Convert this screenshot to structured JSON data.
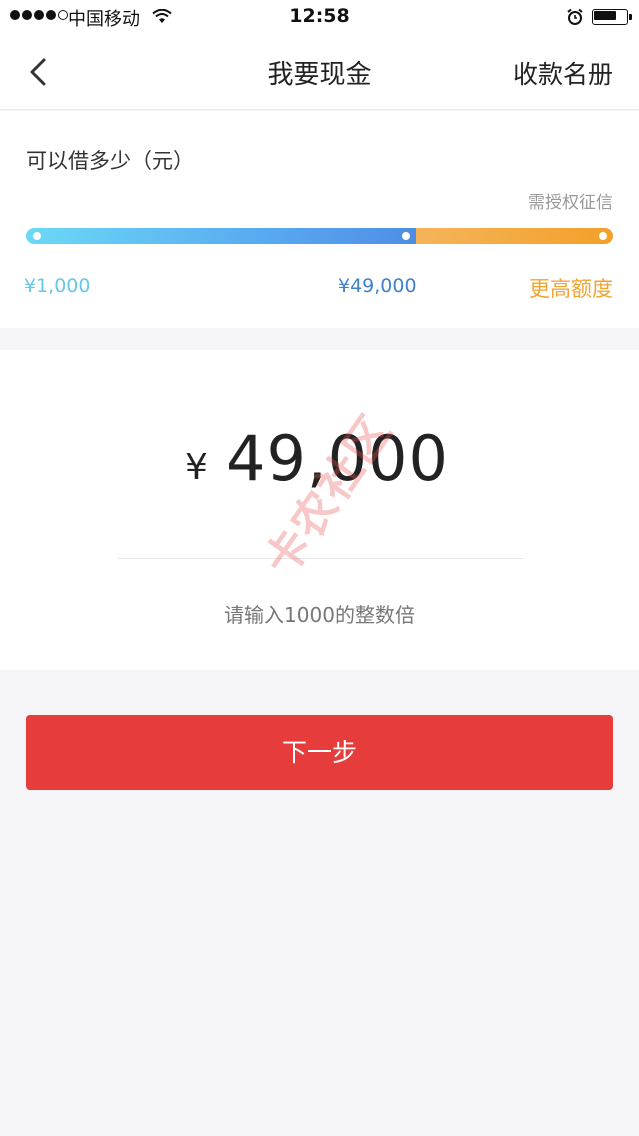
{
  "status_bar": {
    "carrier": "中国移动",
    "time": "12:58",
    "icons": [
      "signal-icon",
      "wifi-icon",
      "alarm-icon",
      "battery-icon"
    ]
  },
  "nav": {
    "back_icon": "chevron-left-icon",
    "title": "我要现金",
    "right_action": "收款名册"
  },
  "limit": {
    "label": "可以借多少（元）",
    "auth_hint": "需授权征信",
    "min_label": "¥1,000",
    "max_label": "¥49,000",
    "more_label": "更高额度",
    "slider_blue_fraction": 0.665
  },
  "amount": {
    "currency": "¥",
    "value": "49,000",
    "hint": "请输入1000的整数倍"
  },
  "watermark": {
    "text": "卡农社区"
  },
  "next_button": {
    "label": "下一步"
  },
  "colors": {
    "accent_red": "#e63c3c",
    "slider_blue": "#59aaf0",
    "slider_orange": "#f3a02a",
    "tick_more": "#f0a430"
  }
}
